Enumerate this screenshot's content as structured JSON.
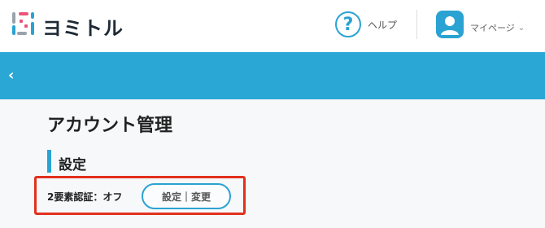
{
  "header": {
    "logo_text": "ヨミトル",
    "help_label": "ヘルプ",
    "mypage_label": "マイページ"
  },
  "page": {
    "title": "アカウント管理",
    "section_title": "設定"
  },
  "two_factor": {
    "status_text": "2要素認証：オフ",
    "button_label": "設定｜変更"
  },
  "colors": {
    "accent": "#2aa3d3",
    "bar": "#2ba7d6",
    "highlight": "#e2311d",
    "logo_pink": "#e9557a",
    "logo_blue": "#2aa3d3",
    "logo_gray": "#9aa3ab"
  },
  "icons": {
    "back": "chevron-left-icon",
    "help": "question-circle-icon",
    "avatar": "user-icon",
    "dropdown": "chevron-down-icon"
  }
}
